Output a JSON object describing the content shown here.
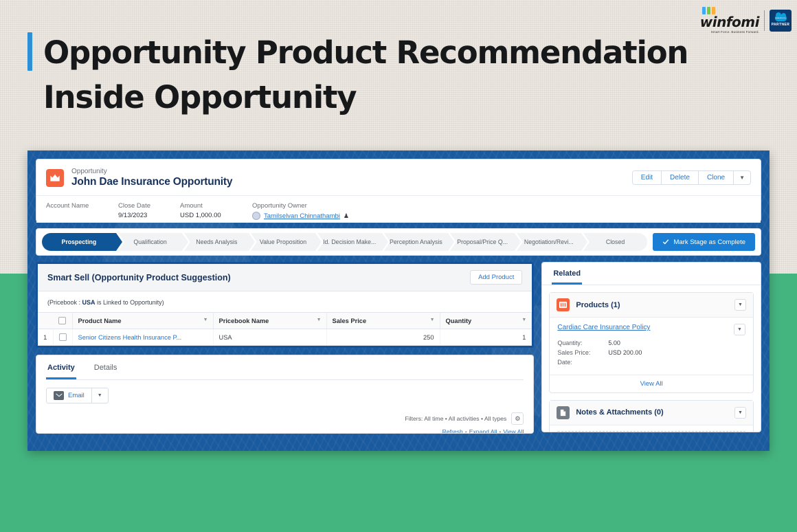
{
  "slide": {
    "title": "Opportunity Product Recommendation Inside Opportunity",
    "accent_bar_color": "#2d8fd5",
    "background_color": "#ece8e1",
    "band_color": "#45b57f"
  },
  "brand": {
    "name": "winfomi",
    "tagline": "Smart Force. Business Forward.",
    "partner_badge_cloud": "salesforce",
    "partner_badge_label": "PARTNER"
  },
  "record_header": {
    "object_label": "Opportunity",
    "record_name": "John Dae Insurance Opportunity",
    "icon": "crown-icon",
    "actions": [
      "Edit",
      "Delete",
      "Clone"
    ],
    "more_actions_icon": "chevron-down-icon",
    "fields": [
      {
        "label": "Account Name",
        "value": ""
      },
      {
        "label": "Close Date",
        "value": "9/13/2023"
      },
      {
        "label": "Amount",
        "value": "USD 1,000.00"
      },
      {
        "label": "Opportunity Owner",
        "value": "Tamilselvan Chinnathambi"
      }
    ]
  },
  "path": {
    "stages": [
      "Prospecting",
      "Qualification",
      "Needs Analysis",
      "Value Proposition",
      "Id. Decision Make...",
      "Perception Analysis",
      "Proposal/Price Q...",
      "Negotiation/Revi...",
      "Closed"
    ],
    "current_stage": "Prospecting",
    "mark_complete_label": "Mark Stage as Complete",
    "mark_complete_icon": "check-icon",
    "button_color": "#1a7fd4",
    "active_stage_color": "#0f5699"
  },
  "smart_sell": {
    "title": "Smart Sell (Opportunity Product Suggestion)",
    "add_product_label": "Add Product",
    "pricebook_prefix": "(Pricebook : ",
    "pricebook_name": "USA",
    "pricebook_suffix": " is Linked to Opportunity)",
    "highlight_border_color": "#14529b",
    "columns": [
      "Product Name",
      "Pricebook Name",
      "Sales Price",
      "Quantity"
    ],
    "rows": [
      {
        "index": "1",
        "product_name": "Senior Citizens Health Insurance P...",
        "pricebook_name": "USA",
        "sales_price": "250",
        "quantity": "1"
      }
    ]
  },
  "activity": {
    "tabs": [
      "Activity",
      "Details"
    ],
    "active_tab": "Activity",
    "email_button_label": "Email",
    "email_icon": "envelope-icon",
    "filters_text": "Filters: All time • All activities • All types",
    "gear_icon": "gear-icon",
    "links": [
      "Refresh",
      "Expand All",
      "View All"
    ]
  },
  "related": {
    "tab_label": "Related",
    "cards": [
      {
        "title": "Products (1)",
        "icon": "products-icon",
        "icon_color": "#f3643f",
        "item_link": "Cardiac Care Insurance Policy",
        "fields": [
          {
            "key": "Quantity:",
            "value": "5.00"
          },
          {
            "key": "Sales Price:",
            "value": "USD 200.00"
          },
          {
            "key": "Date:",
            "value": ""
          }
        ],
        "view_all_label": "View All"
      },
      {
        "title": "Notes & Attachments (0)",
        "icon": "notes-icon",
        "icon_color": "#747c85"
      }
    ]
  }
}
